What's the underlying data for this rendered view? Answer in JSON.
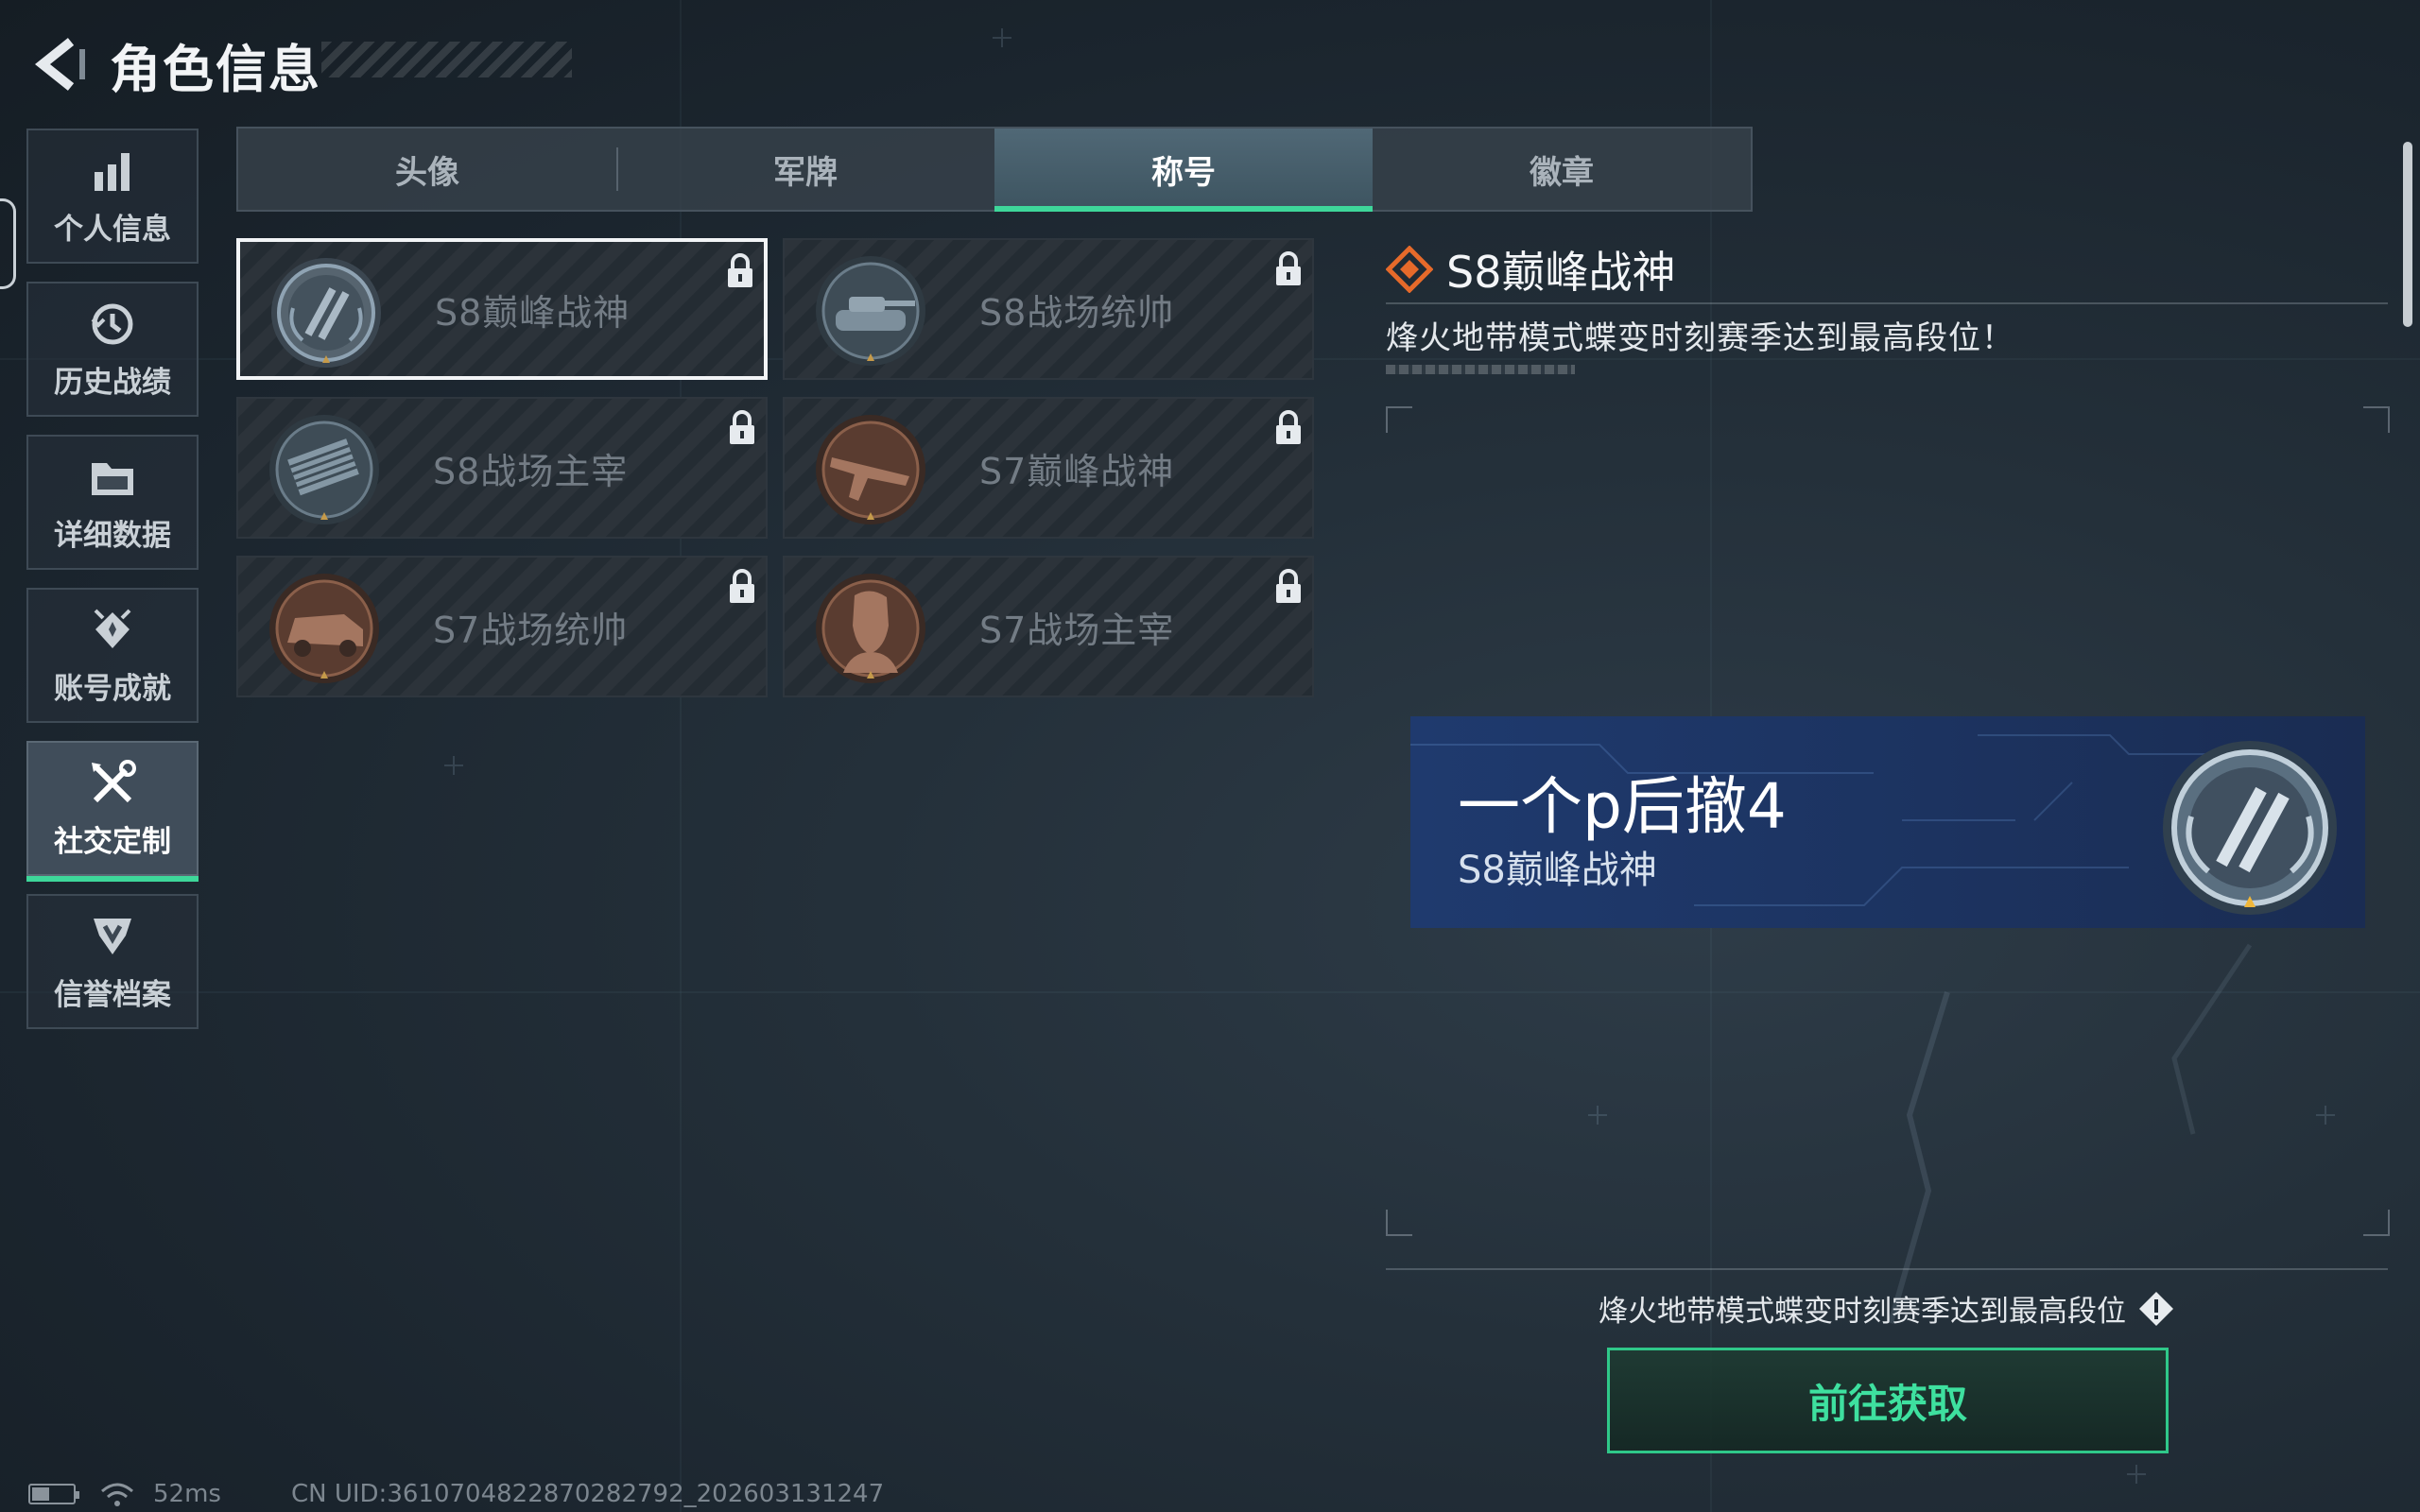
{
  "header": {
    "title": "角色信息"
  },
  "sidebar": {
    "items": [
      {
        "label": "个人信息",
        "icon": "bar-chart-icon",
        "active": false
      },
      {
        "label": "历史战绩",
        "icon": "history-clock-icon",
        "active": false
      },
      {
        "label": "详细数据",
        "icon": "folder-icon",
        "active": false
      },
      {
        "label": "账号成就",
        "icon": "achievement-badge-icon",
        "active": false
      },
      {
        "label": "社交定制",
        "icon": "tools-icon",
        "active": true
      },
      {
        "label": "信誉档案",
        "icon": "credit-shield-icon",
        "active": false
      }
    ]
  },
  "tabs": [
    {
      "label": "头像",
      "active": false
    },
    {
      "label": "军牌",
      "active": false
    },
    {
      "label": "称号",
      "active": true
    },
    {
      "label": "徽章",
      "active": false
    }
  ],
  "titles": [
    {
      "name": "S8巅峰战神",
      "locked": true,
      "selected": true,
      "emblem": "peak-warlord-emblem"
    },
    {
      "name": "S8战场统帅",
      "locked": true,
      "selected": false,
      "emblem": "tank-emblem"
    },
    {
      "name": "S8战场主宰",
      "locked": true,
      "selected": false,
      "emblem": "rocket-launcher-emblem"
    },
    {
      "name": "S7巅峰战神",
      "locked": true,
      "selected": false,
      "emblem": "rifle-emblem"
    },
    {
      "name": "S7战场统帅",
      "locked": true,
      "selected": false,
      "emblem": "armored-vehicle-emblem"
    },
    {
      "name": "S7战场主宰",
      "locked": true,
      "selected": false,
      "emblem": "soldier-portrait-emblem"
    }
  ],
  "detail": {
    "title": "S8巅峰战神",
    "description": "烽火地带模式蝶变时刻赛季达到最高段位！",
    "banner": {
      "player_name": "一个p后撤4",
      "title": "S8巅峰战神"
    },
    "requirement": "烽火地带模式蝶变时刻赛季达到最高段位",
    "action_label": "前往获取"
  },
  "status": {
    "ping": "52ms",
    "uid": "CN UID:361070482287028279​2_202603131247"
  },
  "colors": {
    "accent": "#3ed79a",
    "emblem_silver": "#8fa3b3",
    "emblem_bronze": "#7a5240",
    "banner_blue": "#1f3a6e",
    "diamond_orange": "#e66a2a"
  }
}
